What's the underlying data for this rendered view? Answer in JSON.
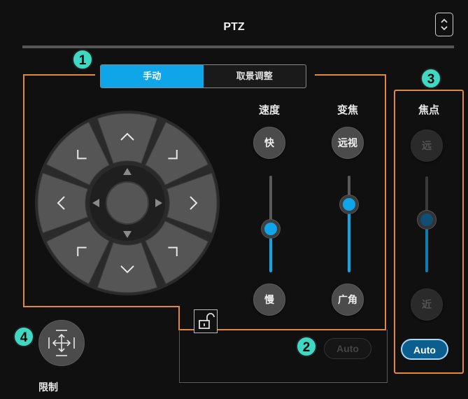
{
  "header": {
    "title": "PTZ"
  },
  "tabs": [
    {
      "label": "手动"
    },
    {
      "label": "取景调整"
    }
  ],
  "badges": [
    "1",
    "2",
    "3",
    "4"
  ],
  "speed": {
    "label": "速度",
    "fast": "快",
    "slow": "慢",
    "level": 0.45
  },
  "zoom": {
    "label": "变焦",
    "tele": "远视",
    "wide": "广角",
    "level": 0.7
  },
  "focus": {
    "label": "焦点",
    "far": "远",
    "near": "近",
    "level": 0.55,
    "auto": "Auto"
  },
  "ptz_auto": {
    "label": "Auto"
  },
  "limit": {
    "label": "限制"
  },
  "colors": {
    "accent": "#0ea5e9",
    "highlight": "#e0893c",
    "badge": "#3fd9c3"
  }
}
